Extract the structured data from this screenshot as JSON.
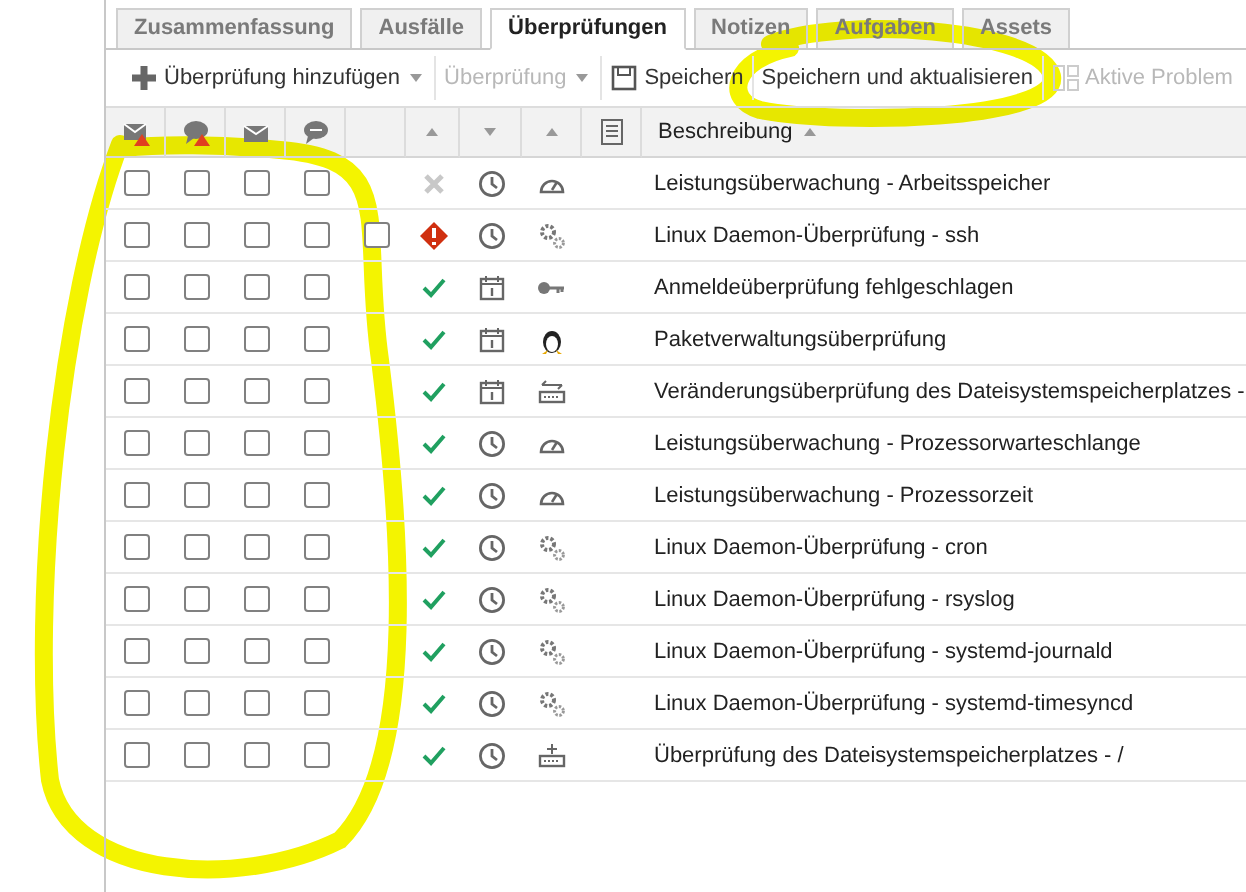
{
  "tabs": [
    {
      "label": "Zusammenfassung",
      "selected": false
    },
    {
      "label": "Ausfälle",
      "selected": false
    },
    {
      "label": "Überprüfungen",
      "selected": true
    },
    {
      "label": "Notizen",
      "selected": false
    },
    {
      "label": "Aufgaben",
      "selected": false
    },
    {
      "label": "Assets",
      "selected": false
    }
  ],
  "toolbar": [
    {
      "kind": "add",
      "label": "Überprüfung hinzufügen",
      "disabled": false
    },
    {
      "kind": "menu",
      "label": "Überprüfung",
      "disabled": true
    },
    {
      "kind": "save",
      "label": "Speichern",
      "disabled": false
    },
    {
      "kind": "plain",
      "label": "Speichern und aktualisieren",
      "disabled": false
    },
    {
      "kind": "split",
      "label": "Aktive Problem",
      "disabled": true
    }
  ],
  "header": {
    "description": "Beschreibung"
  },
  "rows": [
    {
      "checks": [
        false,
        false,
        false,
        false
      ],
      "status": {
        "kind": "inactive"
      },
      "schedule": {
        "kind": "clock"
      },
      "type": {
        "kind": "gauge"
      },
      "description": "Leistungsüberwachung - Arbeitsspeicher"
    },
    {
      "checks": [
        false,
        false,
        false,
        false
      ],
      "extra": {
        "checked": false
      },
      "status": {
        "kind": "error"
      },
      "schedule": {
        "kind": "clock"
      },
      "type": {
        "kind": "gears"
      },
      "description": "Linux Daemon-Überprüfung - ssh"
    },
    {
      "checks": [
        false,
        false,
        false,
        false
      ],
      "status": {
        "kind": "ok"
      },
      "schedule": {
        "kind": "calendar"
      },
      "type": {
        "kind": "key"
      },
      "description": "Anmeldeüberprüfung fehlgeschlagen"
    },
    {
      "checks": [
        false,
        false,
        false,
        false
      ],
      "status": {
        "kind": "ok"
      },
      "schedule": {
        "kind": "calendar"
      },
      "type": {
        "kind": "penguin"
      },
      "description": "Paketverwaltungsüberprüfung"
    },
    {
      "checks": [
        false,
        false,
        false,
        false
      ],
      "status": {
        "kind": "ok"
      },
      "schedule": {
        "kind": "calendar"
      },
      "type": {
        "kind": "drive-arrows"
      },
      "description": "Veränderungsüberprüfung des Dateisystemspeicherplatzes -"
    },
    {
      "checks": [
        false,
        false,
        false,
        false
      ],
      "status": {
        "kind": "ok"
      },
      "schedule": {
        "kind": "clock"
      },
      "type": {
        "kind": "gauge"
      },
      "description": "Leistungsüberwachung - Prozessorwarteschlange"
    },
    {
      "checks": [
        false,
        false,
        false,
        false
      ],
      "status": {
        "kind": "ok"
      },
      "schedule": {
        "kind": "clock"
      },
      "type": {
        "kind": "gauge"
      },
      "description": "Leistungsüberwachung - Prozessorzeit"
    },
    {
      "checks": [
        false,
        false,
        false,
        false
      ],
      "status": {
        "kind": "ok"
      },
      "schedule": {
        "kind": "clock"
      },
      "type": {
        "kind": "gears"
      },
      "description": "Linux Daemon-Überprüfung - cron"
    },
    {
      "checks": [
        false,
        false,
        false,
        false
      ],
      "status": {
        "kind": "ok"
      },
      "schedule": {
        "kind": "clock"
      },
      "type": {
        "kind": "gears"
      },
      "description": "Linux Daemon-Überprüfung - rsyslog"
    },
    {
      "checks": [
        false,
        false,
        false,
        false
      ],
      "status": {
        "kind": "ok"
      },
      "schedule": {
        "kind": "clock"
      },
      "type": {
        "kind": "gears"
      },
      "description": "Linux Daemon-Überprüfung - systemd-journald"
    },
    {
      "checks": [
        false,
        false,
        false,
        false
      ],
      "status": {
        "kind": "ok"
      },
      "schedule": {
        "kind": "clock"
      },
      "type": {
        "kind": "gears"
      },
      "description": "Linux Daemon-Überprüfung - systemd-timesyncd"
    },
    {
      "checks": [
        false,
        false,
        false,
        false
      ],
      "status": {
        "kind": "ok"
      },
      "schedule": {
        "kind": "clock"
      },
      "type": {
        "kind": "drive-plus"
      },
      "description": "Überprüfung des Dateisystemspeicherplatzes - /"
    }
  ],
  "highlight_marks": [
    {
      "kind": "loop"
    },
    {
      "kind": "loop"
    }
  ]
}
